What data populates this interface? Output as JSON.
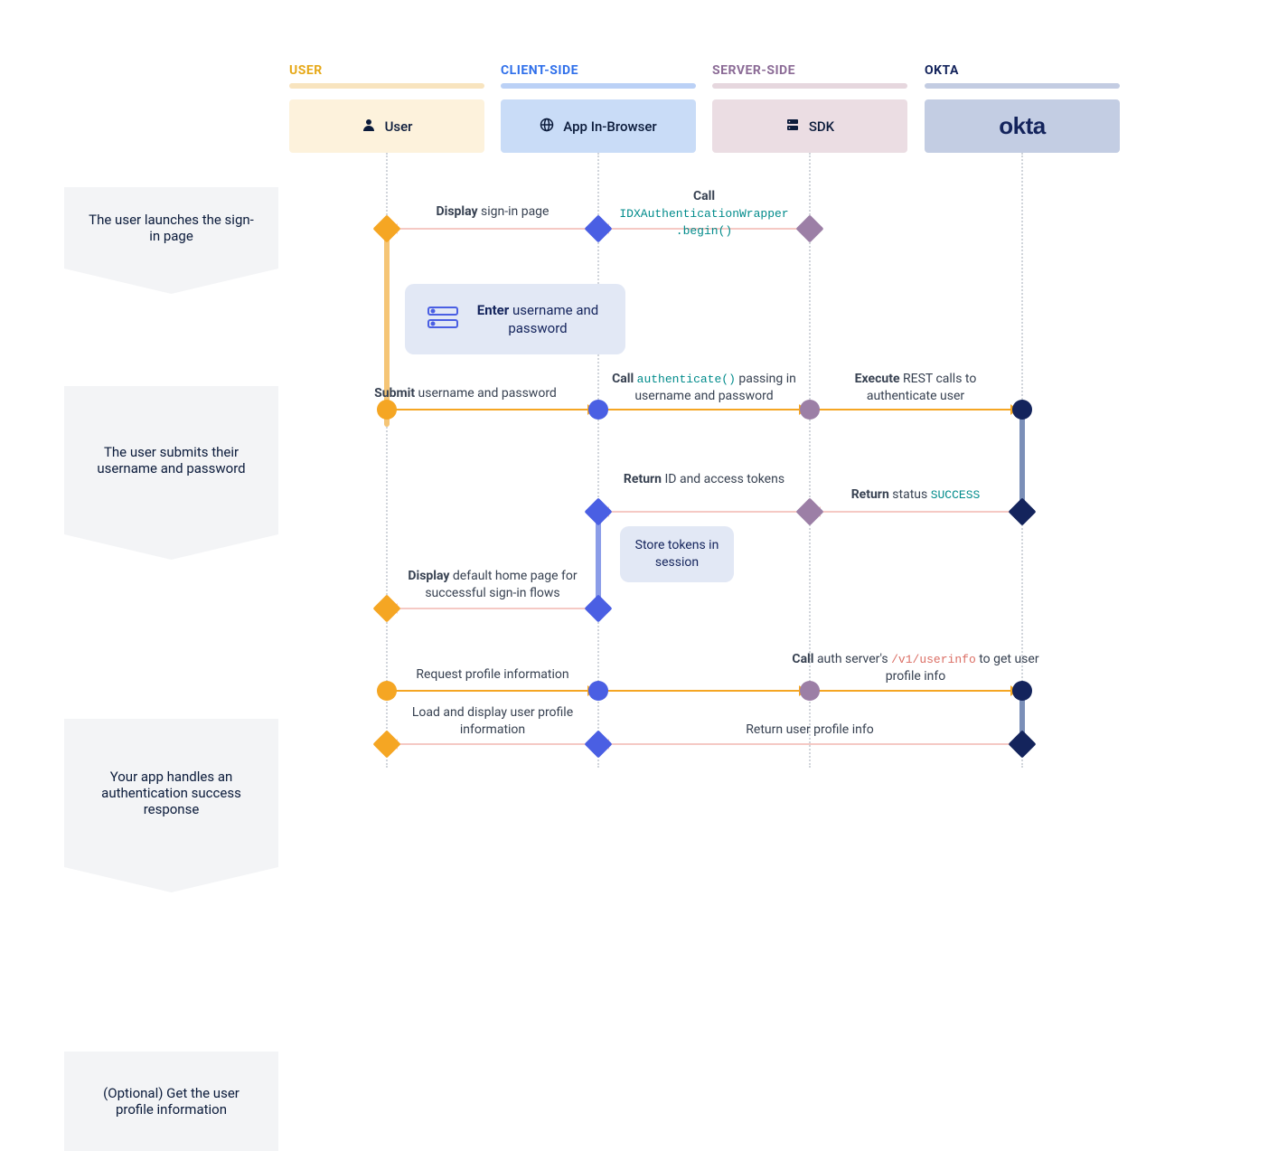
{
  "lanes": {
    "user": {
      "label": "USER",
      "box": "User",
      "color": "#F5A623",
      "barColor": "#F8E4BF",
      "boxBg": "#FDF2DC"
    },
    "client": {
      "label": "CLIENT-SIDE",
      "box": "App In-Browser",
      "color": "#2F6FEA",
      "barColor": "#BBD1F6",
      "boxBg": "#C9DCF7"
    },
    "server": {
      "label": "SERVER-SIDE",
      "box": "SDK",
      "color": "#8B6B96",
      "barColor": "#E6D7DE",
      "boxBg": "#EBDDE3"
    },
    "okta": {
      "label": "OKTA",
      "color": "#14245C",
      "barColor": "#C3CCE2",
      "boxBg": "#C3CDE3"
    }
  },
  "steps": {
    "s1": "The user launches the sign-in page",
    "s2": "The user submits their username and password",
    "s3": "Your app handles an authentication success response",
    "s4": "(Optional) Get the user profile information"
  },
  "bubbles": {
    "enter": {
      "bold": "Enter",
      "rest": " username and password"
    },
    "store": "Store tokens in session"
  },
  "arrows": {
    "a1_call": {
      "bold": "Call",
      "code": "IDXAuthenticationWrapper\n.begin()"
    },
    "a1_display": {
      "bold": "Display",
      "rest": " sign-in page"
    },
    "a2_submit": {
      "bold": "Submit",
      "rest": " username and password"
    },
    "a2_call": {
      "bold": "Call",
      "code": "authenticate()",
      "rest": " passing in username and password"
    },
    "a2_exec": {
      "bold": "Execute",
      "rest": " REST calls to authenticate user"
    },
    "a3_ret_status": {
      "bold": "Return",
      "rest": " status ",
      "code": "SUCCESS"
    },
    "a3_ret_tokens": {
      "bold": "Return",
      "rest": " ID and access tokens"
    },
    "a3_display": {
      "bold": "Display",
      "rest": " default home page for successful sign-in flows"
    },
    "a4_req": "Request profile information",
    "a4_call": {
      "bold": "Call",
      "rest": " auth server's ",
      "code": "/v1/userinfo",
      "rest2": " to get user profile info"
    },
    "a4_ret_server": "Return user profile info",
    "a4_load": "Load and display user profile information"
  }
}
